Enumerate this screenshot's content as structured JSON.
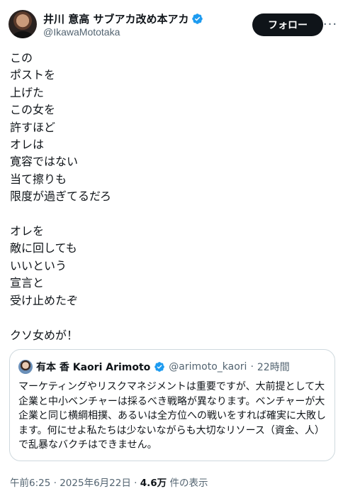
{
  "author": {
    "display_name": "井川 意高 サブアカ改め本アカ",
    "handle": "@IkawaMototaka",
    "verified_icon": "verified-badge-icon",
    "verified_color": "#1d9bf0"
  },
  "actions": {
    "follow_label": "フォロー",
    "more_label": "···"
  },
  "tweet": {
    "text": "この\nポストを\n上げた\nこの女を\n許すほど\nオレは\n寛容ではない\n当て擦りも\n限度が過ぎてるだろ\n\nオレを\n敵に回しても\nいいという\n宣言と\n受け止めたぞ\n\nクソ女めが！"
  },
  "quote": {
    "display_name": "有本 香 Kaori Arimoto",
    "handle": "@arimoto_kaori",
    "separator": "·",
    "time": "22時間",
    "text": "マーケティングやリスクマネジメントは重要ですが、大前提として大企業と中小ベンチャーは採るべき戦略が異なります。ベンチャーが大企業と同じ横綱相撲、あるいは全方位への戦いをすれば確実に大敗します。何にせよ私たちは少ないながらも大切なリソース（資金、人）で乱暴なバクチはできません。"
  },
  "meta": {
    "time": "午前6:25",
    "dot1": "·",
    "date": "2025年6月22日",
    "dot2": "·",
    "views": "4.6万",
    "views_label": "件の表示"
  }
}
